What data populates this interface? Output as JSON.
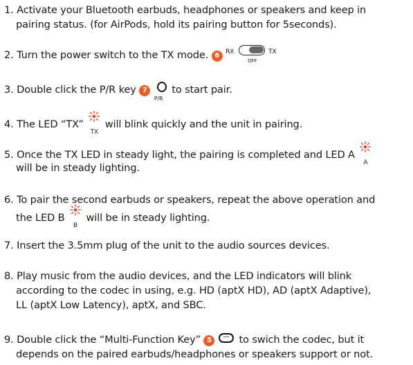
{
  "steps": {
    "s1": {
      "line1": "1. Activate your Bluetooth earbuds, headphones or speakers and keep in",
      "line2": "pairing status. (for AirPods, hold its pairing button for 5seconds)."
    },
    "s2": {
      "text": "2. Turn the power switch to the TX mode.",
      "badge": "6",
      "rx": "RX",
      "tx": "TX",
      "off": "OFF"
    },
    "s3": {
      "pre": "3. Double click the P/R key",
      "badge": "7",
      "key_label": "P/R",
      "post": "to start pair."
    },
    "s4": {
      "pre": "4. The LED “TX”",
      "led_label": "TX",
      "post": "will blink quickly and the unit in pairing."
    },
    "s5": {
      "line1": "5. Once the TX LED in steady light, the pairing is completed and LED A",
      "led_label": "A",
      "line2": "will be in steady lighting."
    },
    "s6": {
      "line1": "6. To pair the second earbuds or speakers, repeat the above operation and",
      "pre2": "the LED B",
      "led_label": "B",
      "post2": "will be in steady lighting."
    },
    "s7": {
      "text": "7. Insert the 3.5mm plug of the unit to the audio sources devices."
    },
    "s8": {
      "line1": "8. Play music from the audio devices, and the LED indicators will blink",
      "line2": "according to the codec in using, e.g. HD (aptX HD), AD (aptX Adaptive),",
      "line3": "LL (aptX Low Latency), aptX, and SBC."
    },
    "s9": {
      "pre": "9. Double click the “Multi-Function Key”",
      "badge": "5",
      "post": "to swich the codec, but it",
      "line2": "depends on the paired earbuds/headphones or speakers support or not."
    }
  },
  "colors": {
    "badge": "#ef5b24",
    "led": "#ef3b24",
    "text": "#1a1a1a"
  },
  "icons": {
    "led": "led-blink-icon",
    "toggle": "power-switch-icon",
    "pr": "pr-key-icon",
    "mfk": "multi-function-key-icon"
  }
}
